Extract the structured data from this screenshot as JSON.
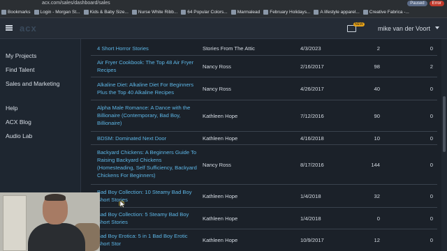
{
  "browser": {
    "url": "acx.com/sales/dashboard/sales",
    "paused_label": "Paused",
    "error_label": "Error",
    "bookmarks": [
      "Bookmarks",
      "Login - Morgan St...",
      "Kids & Baby Size...",
      "Nurse White Ribb...",
      "64 Popular Colors...",
      "Marmalead",
      "February Holidays...",
      "A lifestyle apparel...",
      "Creative Fabrica -..."
    ]
  },
  "header": {
    "logo": "acx",
    "mail_badge": "NEW",
    "user_name": "mike van der Voort"
  },
  "sidebar": {
    "items": [
      "My Projects",
      "Find Talent",
      "Sales and Marketing",
      "Help",
      "ACX Blog",
      "Audio Lab"
    ]
  },
  "table": {
    "rows": [
      {
        "title": "4 Short Horror Stories",
        "author": "Stories From The Attic",
        "date": "4/3/2023",
        "col1": "2",
        "col2": "0"
      },
      {
        "title": "Air Fryer Cookbook: The Top 48 Air Fryer Recipes",
        "author": "Nancy Ross",
        "date": "2/16/2017",
        "col1": "98",
        "col2": "2"
      },
      {
        "title": "Alkaline Diet: Alkaline Diet For Beginners Plus the Top 40 Alkaline Recipes",
        "author": "Nancy Ross",
        "date": "4/26/2017",
        "col1": "40",
        "col2": "0"
      },
      {
        "title": "Alpha Male Romance: A Dance with the Billionaire (Contemporary, Bad Boy, Billionaire)",
        "author": "Kathleen Hope",
        "date": "7/12/2016",
        "col1": "90",
        "col2": "0"
      },
      {
        "title": "BDSM: Dominated Next Door",
        "author": "Kathleen Hope",
        "date": "4/16/2018",
        "col1": "10",
        "col2": "0"
      },
      {
        "title": "Backyard Chickens: A Beginners Guide To Raising Backyard Chickens (Homesteading, Self Sufficiency, Backyard Chickens For Beginners)",
        "author": "Nancy Ross",
        "date": "8/17/2016",
        "col1": "144",
        "col2": "0"
      },
      {
        "title": "Bad Boy Collection: 10 Steamy Bad Boy Short Stories",
        "author": "Kathleen Hope",
        "date": "1/4/2018",
        "col1": "32",
        "col2": "0"
      },
      {
        "title": "Bad Boy Collection: 5 Steamy Bad Boy Short Stories",
        "author": "Kathleen Hope",
        "date": "1/4/2018",
        "col1": "0",
        "col2": "0"
      },
      {
        "title": "Bad Boy Erotica: 5 in 1 Bad Boy Erotic Short Stor",
        "author": "Kathleen Hope",
        "date": "10/9/2017",
        "col1": "12",
        "col2": "0"
      }
    ]
  }
}
